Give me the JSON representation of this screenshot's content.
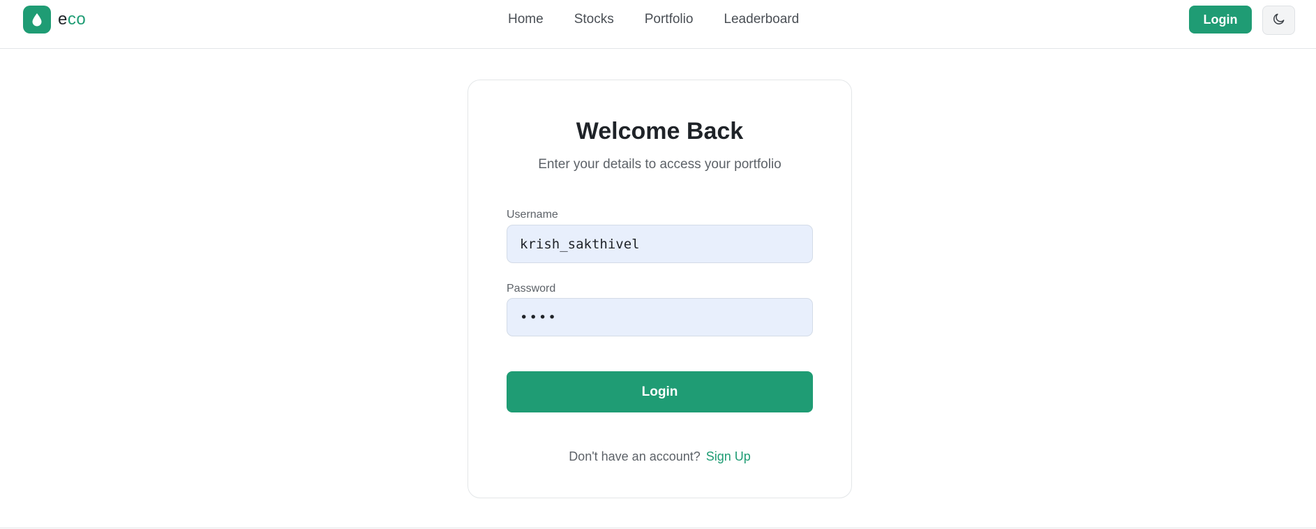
{
  "brand": {
    "name_part1": "e",
    "name_part2": "co",
    "logo_icon": "drop-icon"
  },
  "nav": {
    "items": [
      {
        "label": "Home"
      },
      {
        "label": "Stocks"
      },
      {
        "label": "Portfolio"
      },
      {
        "label": "Leaderboard"
      }
    ]
  },
  "header": {
    "login_label": "Login",
    "theme_icon": "moon-icon"
  },
  "login_card": {
    "title": "Welcome Back",
    "subtitle": "Enter your details to access your portfolio",
    "username_label": "Username",
    "username_value": "krish_sakthivel",
    "password_label": "Password",
    "password_value": "••••",
    "submit_label": "Login",
    "signup_prompt": "Don't have an account?",
    "signup_link": "Sign Up"
  },
  "colors": {
    "accent": "#1f9c74",
    "input_bg": "#e8effc"
  }
}
